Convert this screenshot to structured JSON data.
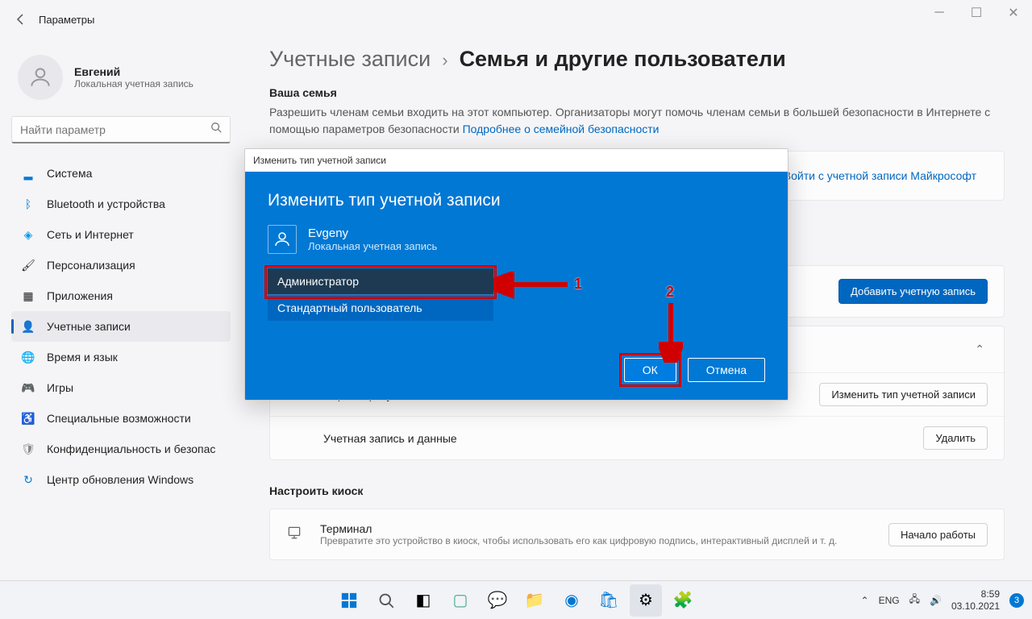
{
  "window": {
    "title": "Параметры"
  },
  "user": {
    "name": "Евгений",
    "subtitle": "Локальная учетная запись"
  },
  "search": {
    "placeholder": "Найти параметр"
  },
  "nav": {
    "system": "Система",
    "bluetooth": "Bluetooth и устройства",
    "network": "Сеть и Интернет",
    "personalization": "Персонализация",
    "apps": "Приложения",
    "accounts": "Учетные записи",
    "time": "Время и язык",
    "gaming": "Игры",
    "accessibility": "Специальные возможности",
    "privacy": "Конфиденциальность и безопас",
    "update": "Центр обновления Windows"
  },
  "breadcrumb": {
    "level1": "Учетные записи",
    "level2": "Семья и другие пользователи"
  },
  "family": {
    "heading": "Ваша семья",
    "desc_part1": "Разрешить членам семьи входить на этот компьютер. Организаторы могут помочь членам семьи в большей безопасности в Интернете с помощью параметров безопасности  ",
    "link": "Подробнее о семейной безопасности",
    "signin_btn": "Войти с учетной записи Майкрософт"
  },
  "other_users": {
    "add_btn": "Добавить учетную запись"
  },
  "account_options": {
    "row_label": "Параметры учетной записи",
    "change_type_btn": "Изменить тип учетной записи",
    "data_row": "Учетная запись и данные",
    "delete_btn": "Удалить"
  },
  "kiosk": {
    "heading": "Настроить киоск",
    "title": "Терминал",
    "desc": "Превратите это устройство в киоск, чтобы использовать его как цифровую подпись, интерактивный дисплей и т. д.",
    "start_btn": "Начало работы"
  },
  "dialog": {
    "titlebar": "Изменить тип учетной записи",
    "heading": "Изменить тип учетной записи",
    "user_name": "Evgeny",
    "user_sub": "Локальная учетная запись",
    "opt_admin": "Администратор",
    "opt_standard": "Стандартный пользователь",
    "ok": "ОК",
    "cancel": "Отмена"
  },
  "annotations": {
    "n1": "1",
    "n2": "2"
  },
  "tray": {
    "lang": "ENG",
    "time": "8:59",
    "date": "03.10.2021",
    "badge": "3"
  }
}
